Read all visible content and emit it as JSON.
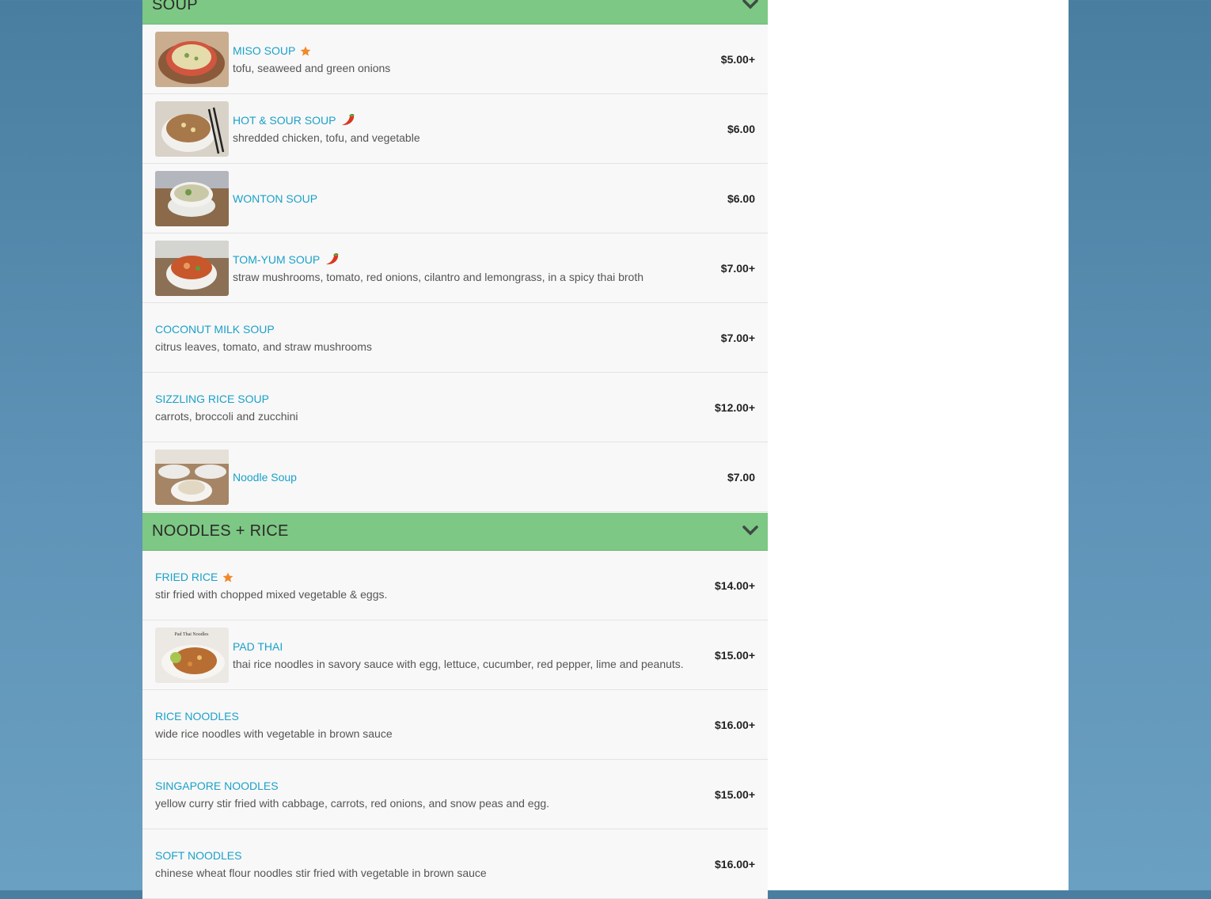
{
  "categories": [
    {
      "title": "SOUP",
      "items": [
        {
          "name": "MISO SOUP",
          "desc": "tofu, seaweed and green onions",
          "price": "$5.00+",
          "badge": "star-icon"
        },
        {
          "name": "HOT & SOUR SOUP",
          "desc": "shredded chicken, tofu, and vegetable",
          "price": "$6.00",
          "badge": "chili-pepper-icon"
        },
        {
          "name": "WONTON SOUP",
          "desc": "",
          "price": "$6.00",
          "badge": ""
        },
        {
          "name": "TOM-YUM SOUP",
          "desc": "straw mushrooms, tomato, red onions, cilantro and lemongrass, in a spicy thai broth",
          "price": "$7.00+",
          "badge": "chili-pepper-icon"
        },
        {
          "name": "COCONUT MILK SOUP",
          "desc": "citrus leaves, tomato, and straw mushrooms",
          "price": "$7.00+",
          "badge": ""
        },
        {
          "name": "SIZZLING RICE SOUP",
          "desc": "carrots, broccoli and zucchini",
          "price": "$12.00+",
          "badge": ""
        },
        {
          "name": "Noodle Soup",
          "desc": "",
          "price": "$7.00",
          "badge": ""
        }
      ]
    },
    {
      "title": "NOODLES + RICE",
      "items": [
        {
          "name": "FRIED RICE",
          "desc": "stir fried with chopped mixed vegetable & eggs.",
          "price": "$14.00+",
          "badge": "star-icon"
        },
        {
          "name": "PAD THAI",
          "desc": "thai rice noodles in savory sauce with egg, lettuce, cucumber, red pepper, lime and peanuts.",
          "price": "$15.00+",
          "badge": ""
        },
        {
          "name": "RICE NOODLES",
          "desc": "wide rice noodles with vegetable in brown sauce",
          "price": "$16.00+",
          "badge": ""
        },
        {
          "name": "SINGAPORE NOODLES",
          "desc": "yellow curry stir fried with cabbage, carrots, red onions, and snow peas and egg.",
          "price": "$15.00+",
          "badge": ""
        },
        {
          "name": "SOFT NOODLES",
          "desc": "chinese wheat flour noodles stir fried with vegetable in brown sauce",
          "price": "$16.00+",
          "badge": ""
        }
      ]
    }
  ],
  "colors": {
    "header_bg": "#7dc884",
    "item_name": "#1ba1c9",
    "star": "#f0892a",
    "chili": "#d9381e"
  },
  "thumbnail_photo_text": "Pad Thai Noodles"
}
